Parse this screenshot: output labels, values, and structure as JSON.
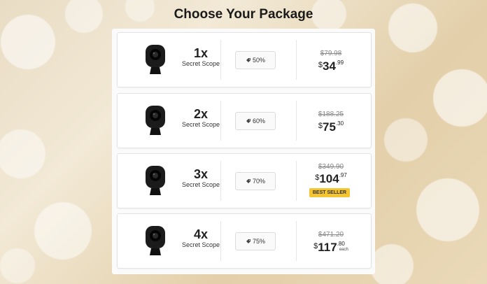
{
  "header": {
    "title": "Choose Your Package"
  },
  "packages": [
    {
      "quantity": "1x",
      "product": "Secret Scope",
      "discount": "50%",
      "old_price": "$79.98",
      "currency": "$",
      "price_whole": "34",
      "price_cents": ".99",
      "badge": "",
      "unit_note": ""
    },
    {
      "quantity": "2x",
      "product": "Secret Scope",
      "discount": "60%",
      "old_price": "$188.25",
      "currency": "$",
      "price_whole": "75",
      "price_cents": ".30",
      "badge": "",
      "unit_note": ""
    },
    {
      "quantity": "3x",
      "product": "Secret Scope",
      "discount": "70%",
      "old_price": "$349.90",
      "currency": "$",
      "price_whole": "104",
      "price_cents": ".97",
      "badge": "BEST SELLER",
      "unit_note": ""
    },
    {
      "quantity": "4x",
      "product": "Secret Scope",
      "discount": "75%",
      "old_price": "$471.20",
      "currency": "$",
      "price_whole": "117",
      "price_cents": ".80",
      "badge": "",
      "unit_note": "each"
    }
  ],
  "colors": {
    "badge": "#f5c431",
    "card_border": "#e3e3e3",
    "text": "#222222"
  },
  "icons": {
    "product": "camera-image",
    "discount": "tag-icon"
  }
}
